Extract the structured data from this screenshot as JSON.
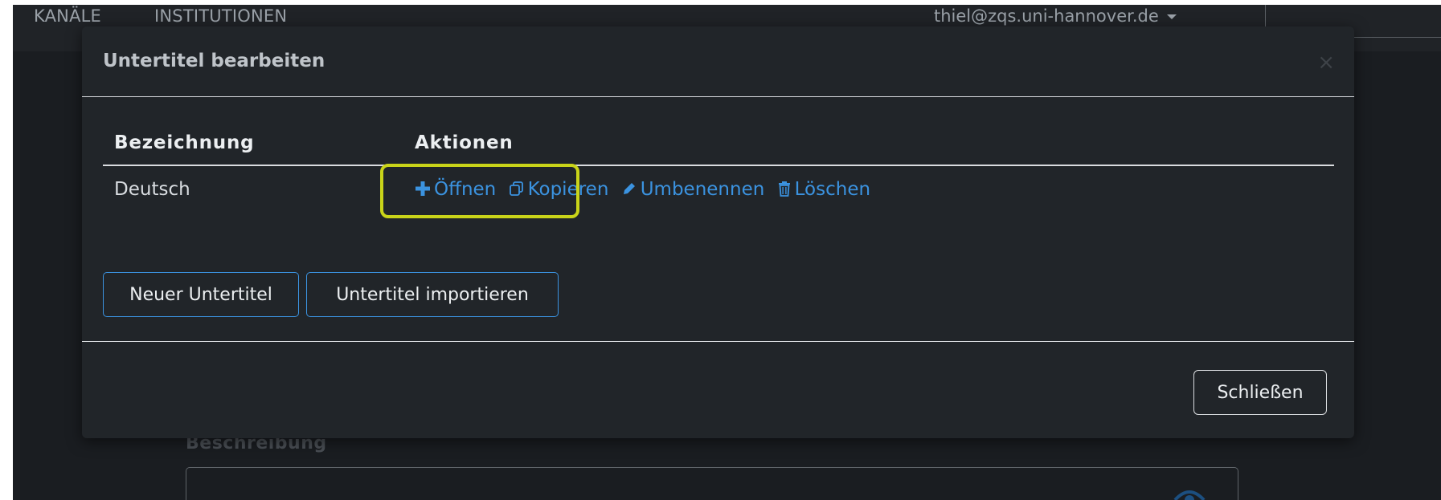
{
  "nav": {
    "kanaele": "KANÄLE",
    "institutionen": "INSTITUTIONEN",
    "user_email": "thiel@zqs.uni-hannover.de"
  },
  "background_form": {
    "description_label": "Beschreibung"
  },
  "modal": {
    "title": "Untertitel bearbeiten",
    "close_symbol": "×",
    "table": {
      "headers": {
        "name": "Bezeichnung",
        "actions": "Aktionen"
      },
      "rows": [
        {
          "name": "Deutsch",
          "actions": {
            "open": "Öffnen",
            "copy": "Kopieren",
            "rename": "Umbenennen",
            "delete": "Löschen"
          }
        }
      ]
    },
    "buttons": {
      "new_subtitle": "Neuer Untertitel",
      "import_subtitle": "Untertitel importieren",
      "close": "Schließen"
    }
  },
  "icons": {
    "open": "plus-icon",
    "copy": "copy-icon",
    "rename": "pencil-icon",
    "delete": "trash-icon",
    "close": "close-icon",
    "preview": "eye-icon",
    "dropdown": "caret-down-icon"
  },
  "colors": {
    "link": "#3b93e0",
    "highlight": "#c9d419",
    "modal_background": "#212529"
  }
}
